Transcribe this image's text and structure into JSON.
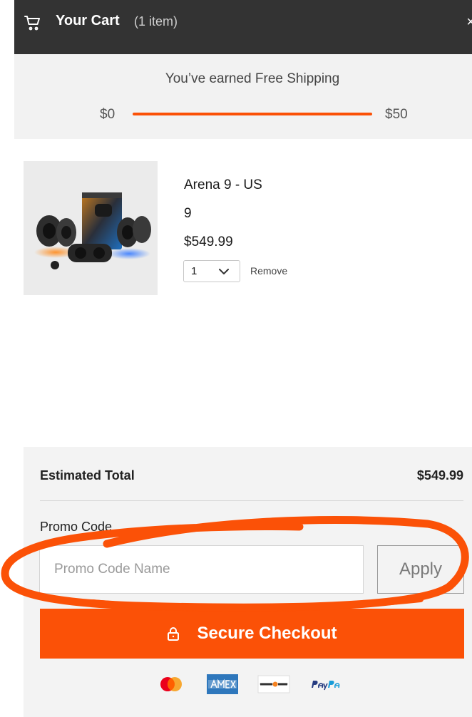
{
  "header": {
    "title": "Your Cart",
    "count": "(1 item)"
  },
  "shipping": {
    "message": "You’ve earned Free Shipping",
    "min_label": "$0",
    "max_label": "$50",
    "progress": 1.0
  },
  "item": {
    "name": "Arena 9 - US",
    "variant": "9",
    "price": "$549.99",
    "quantity": "1",
    "remove_label": "Remove"
  },
  "summary": {
    "total_label": "Estimated Total",
    "total_value": "$549.99",
    "promo_label": "Promo Code",
    "promo_placeholder": "Promo Code Name",
    "apply_label": "Apply",
    "checkout_label": "Secure Checkout"
  },
  "payments": [
    "mastercard-icon",
    "amex-icon",
    "discover-icon",
    "paypal-icon"
  ],
  "colors": {
    "accent": "#fb5107",
    "header_bg": "#333333",
    "panel_bg": "#f3f3f3"
  }
}
